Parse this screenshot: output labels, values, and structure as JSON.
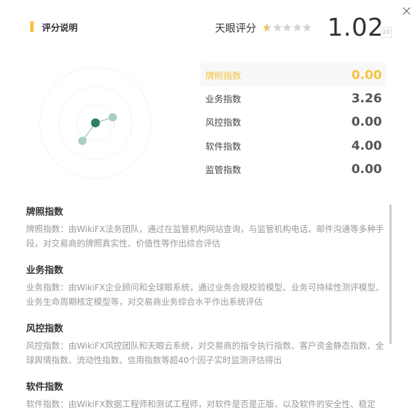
{
  "header": {
    "title": "评分说明",
    "score_label": "天眼评分",
    "score_value": "1.02",
    "score_max": "10",
    "stars": {
      "filled": 0.5,
      "total": 5
    }
  },
  "colors": {
    "accent": "#f5c242",
    "radar_dark": "#2f8063",
    "radar_light": "#a9cdbf"
  },
  "radar": {
    "axes": [
      "牌照指数",
      "业务指数",
      "风控指数",
      "软件指数",
      "监管指数"
    ],
    "values": [
      0.0,
      3.26,
      0.0,
      4.0,
      0.0
    ]
  },
  "indices": [
    {
      "name": "牌照指数",
      "value": "0.00",
      "active": true
    },
    {
      "name": "业务指数",
      "value": "3.26",
      "active": false
    },
    {
      "name": "风控指数",
      "value": "0.00",
      "active": false
    },
    {
      "name": "软件指数",
      "value": "4.00",
      "active": false
    },
    {
      "name": "监管指数",
      "value": "0.00",
      "active": false
    }
  ],
  "descriptions": [
    {
      "title": "牌照指数",
      "text": "牌照指数：由WikiFX法务团队，通过在监管机构网站查询，与监管机构电话、邮件沟通等多种手段，对交易商的牌照真实性、价值性等作出综合评估"
    },
    {
      "title": "业务指数",
      "text": "业务指数：由WikiFX企业顾问和全球眼系统，通过业务合规校验模型、业务可持续性测评模型、业务生命周期核定模型等，对交易商业务综合水平作出系统评估"
    },
    {
      "title": "风控指数",
      "text": "风控指数：由WikiFX风控团队和天眼云系统，对交易商的指令执行指数、客户资金静态指数、全球舆情指数、流动性指数、信用指数等超40个因子实时监测评估得出"
    },
    {
      "title": "软件指数",
      "text": "软件指数：由WikiFX数据工程师和测试工程师，对软件是否是正版，以及软件的安全性、稳定"
    }
  ]
}
